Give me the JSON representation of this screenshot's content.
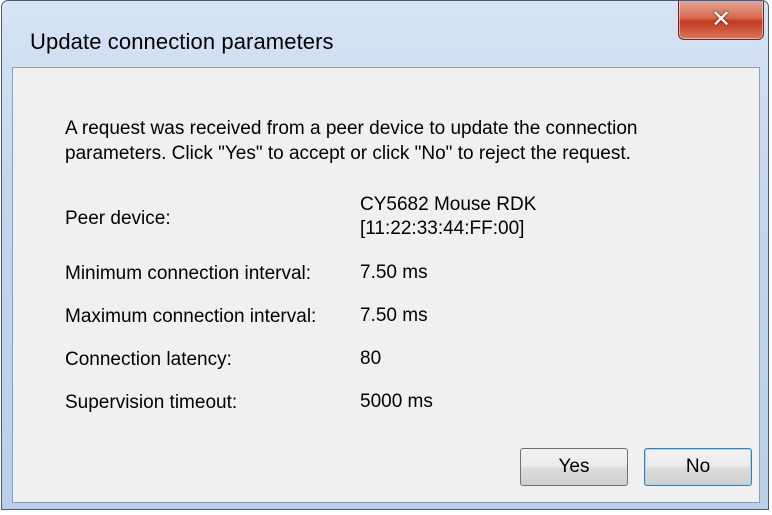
{
  "window": {
    "title": "Update connection parameters",
    "close_icon": "✕"
  },
  "message": {
    "line1": "A request was received from a peer device to update the connection",
    "line2": "parameters. Click \"Yes\" to accept or click \"No\" to reject the request."
  },
  "details": {
    "peer_device_label": "Peer device:",
    "peer_device_name": "CY5682 Mouse RDK",
    "peer_device_address": "[11:22:33:44:FF:00]",
    "min_interval_label": "Minimum connection interval:",
    "min_interval_value": "7.50 ms",
    "max_interval_label": "Maximum connection interval:",
    "max_interval_value": "7.50 ms",
    "latency_label": "Connection latency:",
    "latency_value": "80",
    "timeout_label": "Supervision timeout:",
    "timeout_value": "5000 ms"
  },
  "buttons": {
    "yes_label": "Yes",
    "no_label": "No"
  },
  "colors": {
    "title_bar": "#c2d6ee",
    "close_button": "#c43b1f",
    "dialog_body": "#f0f0f0",
    "default_button_border": "#3c7fb1"
  }
}
